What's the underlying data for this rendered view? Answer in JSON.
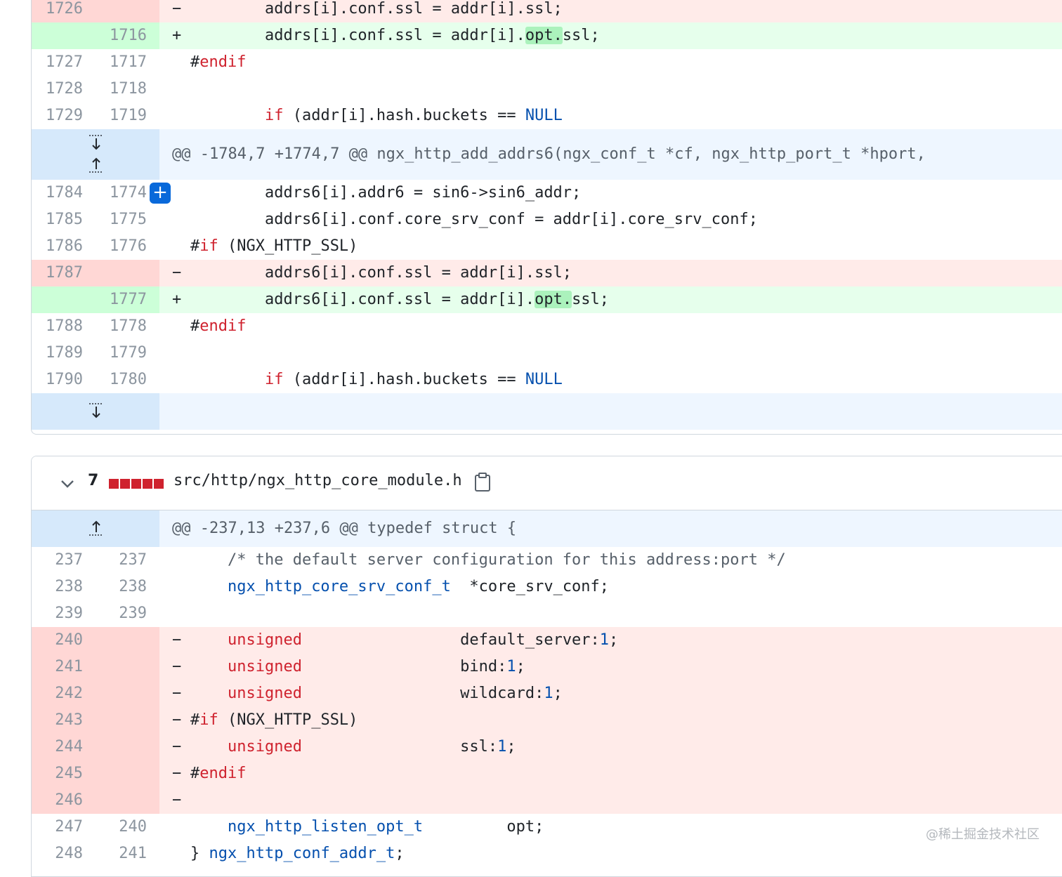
{
  "diff1": {
    "rows_a": [
      {
        "type": "del",
        "old": "1726",
        "new": "",
        "sign": "−",
        "text": "        addrs[i].conf.ssl = addr[i].ssl;"
      },
      {
        "type": "add",
        "old": "",
        "new": "1716",
        "sign": "+"
      },
      {
        "type": "ctx",
        "old": "1727",
        "new": "1717",
        "sign": "",
        "pre": "",
        "kw": "endif"
      },
      {
        "type": "ctx",
        "old": "1728",
        "new": "1718",
        "sign": "",
        "text": ""
      },
      {
        "type": "ctx",
        "old": "1729",
        "new": "1719",
        "sign": ""
      }
    ],
    "line1716": {
      "pre": "        addrs[i].conf.ssl = addr[i].",
      "hl": "opt.",
      "post": "ssl;"
    },
    "line1719": {
      "indent": "        ",
      "kw": "if",
      "mid": " (addr[i].hash.buckets == ",
      "ty": "NULL"
    },
    "hunk": "@@ -1784,7 +1774,7 @@ ngx_http_add_addrs6(ngx_conf_t *cf, ngx_http_port_t *hport,",
    "rows_b": {
      "r1784": {
        "old": "1784",
        "new": "1774",
        "text": "        addrs6[i].addr6 = sin6->sin6_addr;"
      },
      "r1785": {
        "old": "1785",
        "new": "1775",
        "text": "        addrs6[i].conf.core_srv_conf = addr[i].core_srv_conf;"
      },
      "r1786": {
        "old": "1786",
        "new": "1776",
        "hash": "#",
        "kw": "if",
        "post": " (NGX_HTTP_SSL)"
      },
      "r1787": {
        "old": "1787",
        "sign": "−",
        "text": "        addrs6[i].conf.ssl = addr[i].ssl;"
      },
      "r1777": {
        "new": "1777",
        "sign": "+",
        "pre": "        addrs6[i].conf.ssl = addr[i].",
        "hl": "opt.",
        "post": "ssl;"
      },
      "r1788": {
        "old": "1788",
        "new": "1778",
        "hash": "#",
        "kw": "endif"
      },
      "r1789": {
        "old": "1789",
        "new": "1779"
      },
      "r1790": {
        "old": "1790",
        "new": "1780",
        "indent": "        ",
        "kw": "if",
        "mid": " (addr[i].hash.buckets == ",
        "ty": "NULL"
      }
    },
    "endif_hash": "#",
    "line1717_kw": "endif"
  },
  "file2": {
    "count": "7",
    "filename": "src/http/ngx_http_core_module.h",
    "hunk": "@@ -237,13 +237,6 @@ typedef struct {",
    "r237": {
      "old": "237",
      "new": "237",
      "text": "    /* the default server configuration for this address:port */"
    },
    "r238": {
      "old": "238",
      "new": "238",
      "indent": "    ",
      "ty": "ngx_http_core_srv_conf_t",
      "post": "  *core_srv_conf;"
    },
    "r239": {
      "old": "239",
      "new": "239"
    },
    "r240": {
      "old": "240",
      "sign": "−",
      "indent": "    ",
      "kw": "unsigned",
      "mid": "                 default_server:",
      "ty": "1",
      "post": ";"
    },
    "r241": {
      "old": "241",
      "sign": "−",
      "indent": "    ",
      "kw": "unsigned",
      "mid": "                 bind:",
      "ty": "1",
      "post": ";"
    },
    "r242": {
      "old": "242",
      "sign": "−",
      "indent": "    ",
      "kw": "unsigned",
      "mid": "                 wildcard:",
      "ty": "1",
      "post": ";"
    },
    "r243": {
      "old": "243",
      "sign": "−",
      "hash": "#",
      "kw": "if",
      "post": " (NGX_HTTP_SSL)"
    },
    "r244": {
      "old": "244",
      "sign": "−",
      "indent": "    ",
      "kw": "unsigned",
      "mid": "                 ssl:",
      "ty": "1",
      "post": ";"
    },
    "r245": {
      "old": "245",
      "sign": "−",
      "hash": "#",
      "kw": "endif"
    },
    "r246": {
      "old": "246",
      "sign": "−"
    },
    "r247": {
      "old": "247",
      "new": "240",
      "indent": "    ",
      "ty": "ngx_http_listen_opt_t",
      "post": "         opt;"
    },
    "r248": {
      "old": "248",
      "new": "241",
      "pre": "} ",
      "ty": "ngx_http_conf_addr_t",
      "post": ";"
    }
  },
  "watermark": "@稀土掘金技术社区",
  "colors": {
    "deleted": "#ffebe9",
    "added": "#e6ffec",
    "hunk": "#ddf4ff",
    "accent": "#0969da",
    "keyword": "#cf222e",
    "type": "#0550ae"
  },
  "icons": [
    "expand-down-icon",
    "expand-up-icon",
    "add-comment-icon",
    "chevron-down-icon",
    "copy-icon"
  ]
}
